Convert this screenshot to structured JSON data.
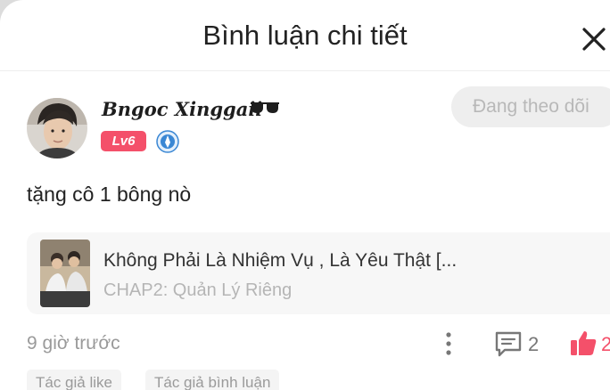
{
  "header": {
    "title": "Bình luận chi tiết",
    "close_icon": "close-icon"
  },
  "comment": {
    "user": {
      "name": "Bngoc Xinggaii",
      "level": "Lv6",
      "badge_color": "#f4506a",
      "name_icon": "sunglasses-icon",
      "medal_icon": "medal-icon"
    },
    "follow_label": "Đang theo dõi",
    "text": "tặng cô 1 bông nò",
    "story": {
      "title": "Không Phải Là Nhiệm Vụ , Là Yêu Thật [...",
      "chapter": "CHAP2: Quản Lý Riêng"
    },
    "time": "9 giờ trước",
    "reply_count": "2",
    "like_count": "2",
    "like_color": "#f4506a",
    "tags": [
      "Tác giả like",
      "Tác giả bình luận"
    ]
  }
}
